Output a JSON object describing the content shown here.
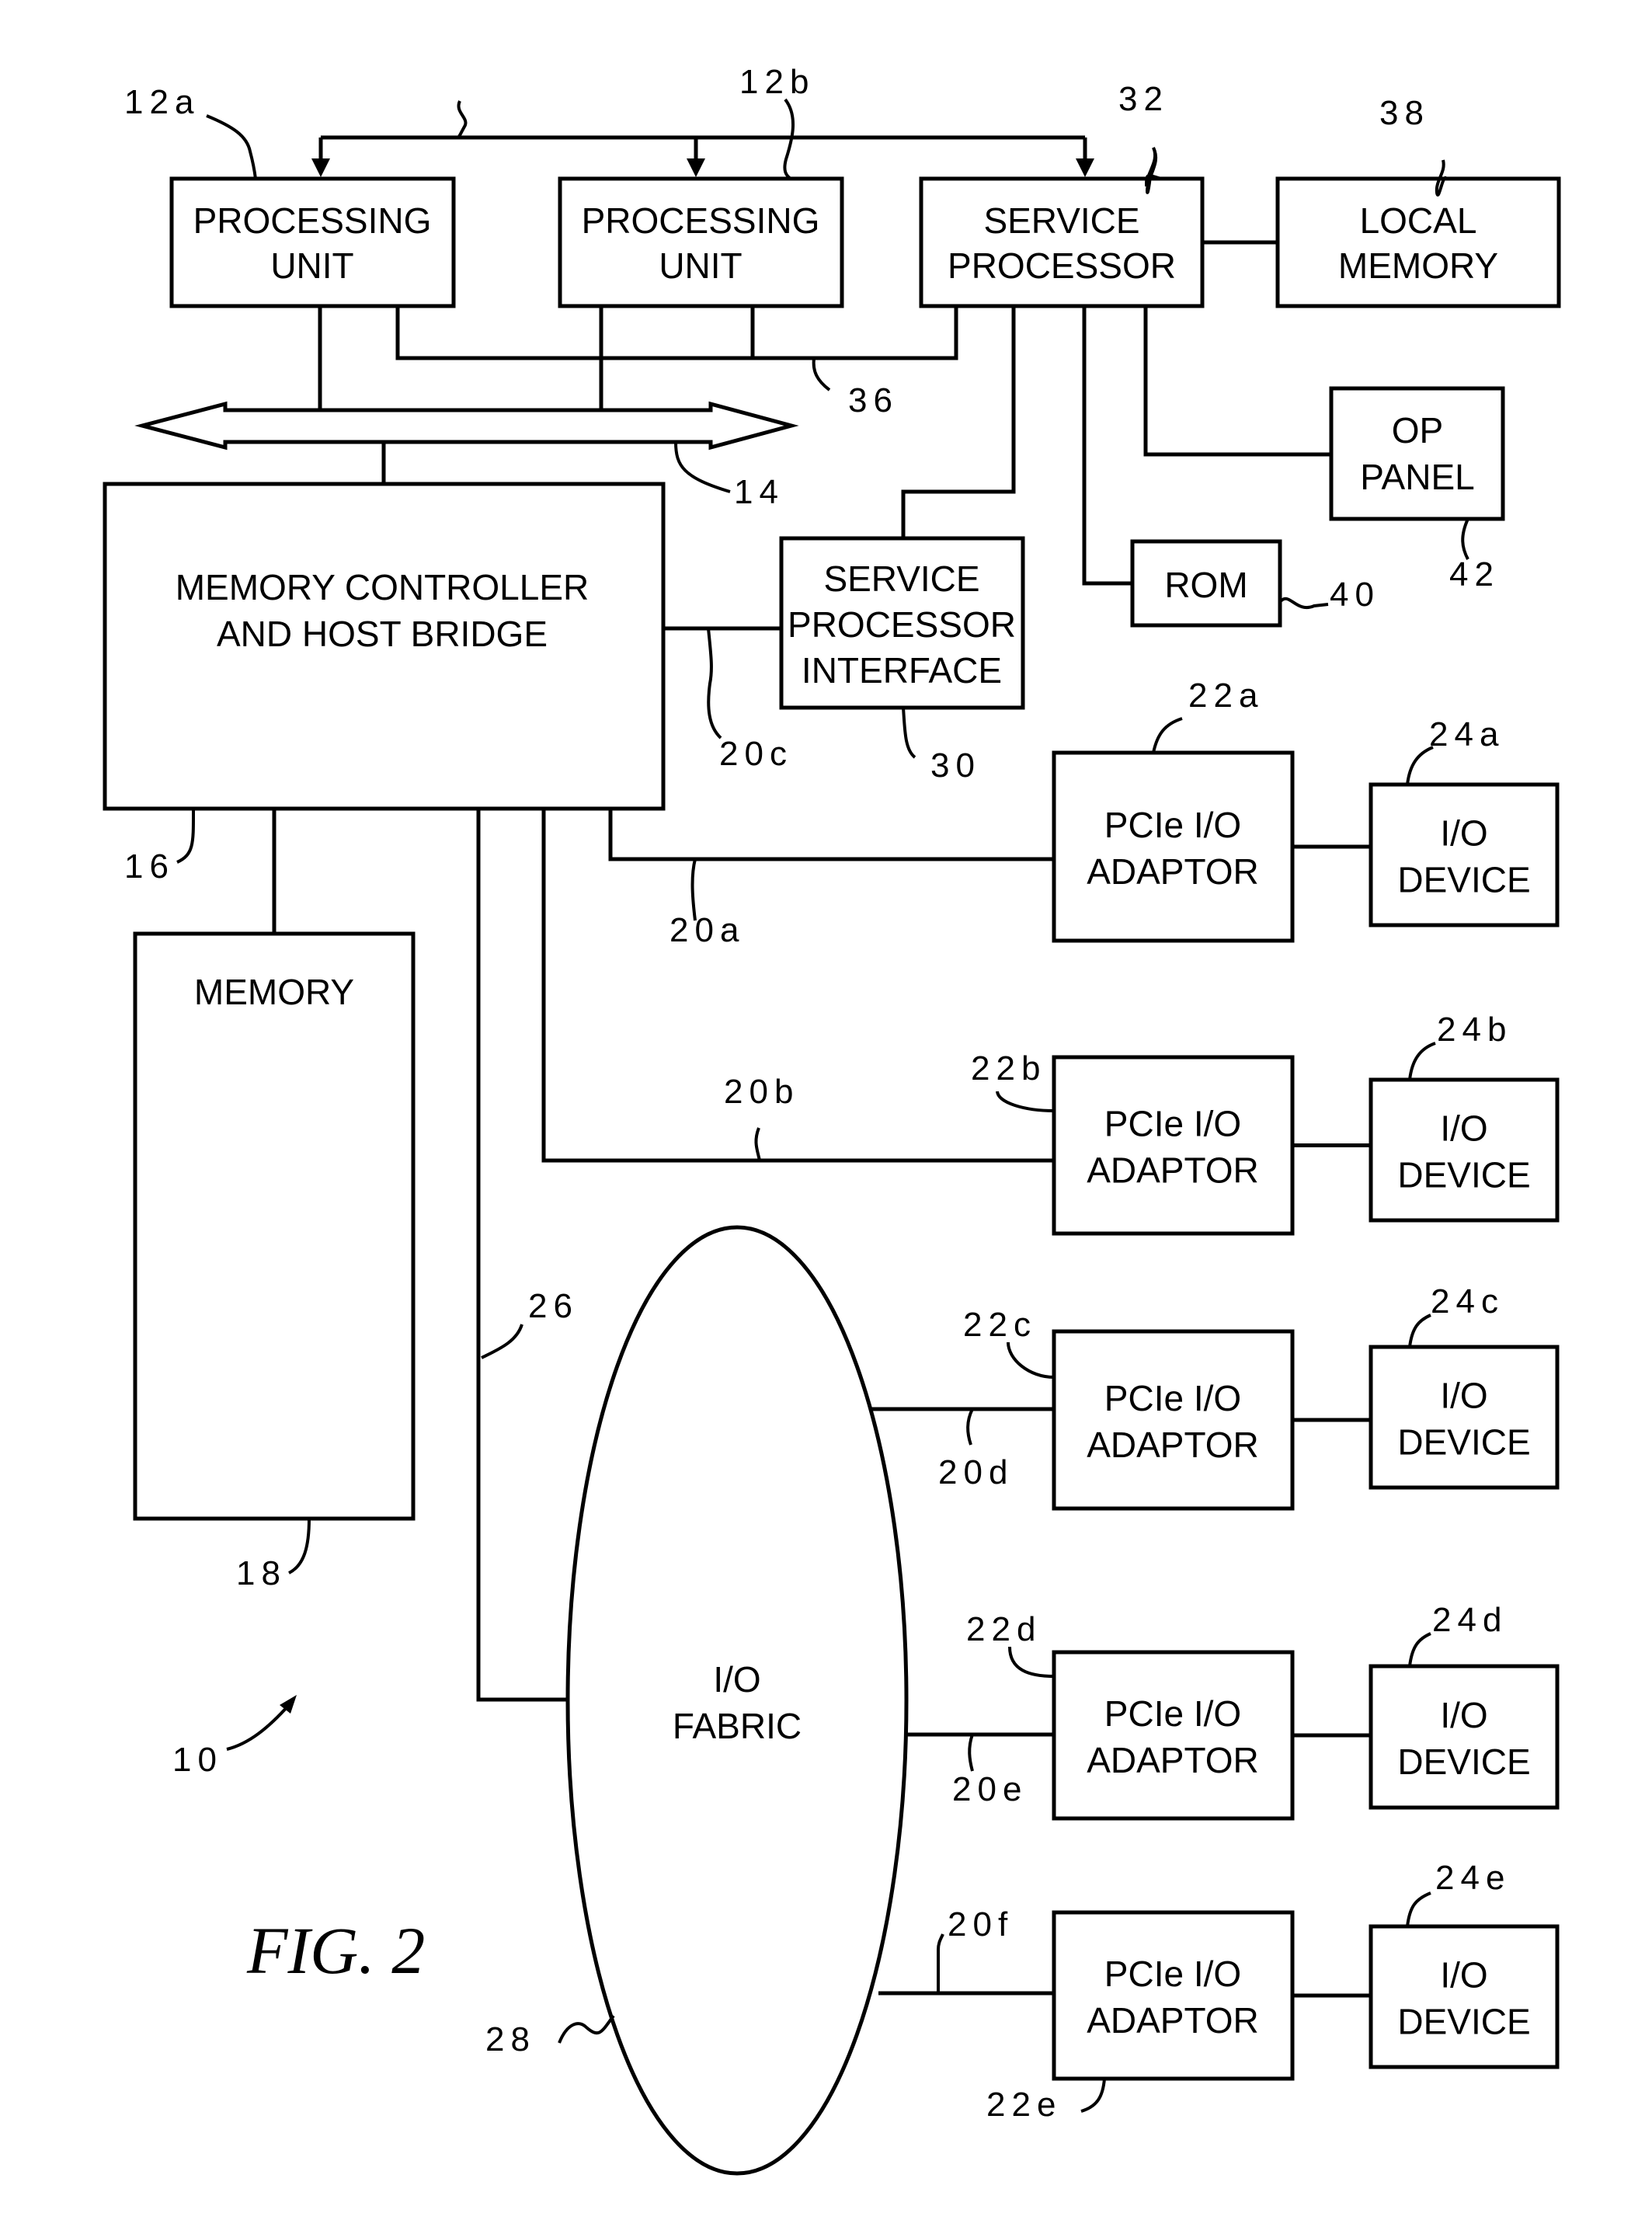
{
  "figure": {
    "caption": "FIG. 2",
    "system_ref": "10"
  },
  "blocks": {
    "processing_unit_a": {
      "line1": "PROCESSING",
      "line2": "UNIT",
      "ref": "12a"
    },
    "processing_unit_b": {
      "line1": "PROCESSING",
      "line2": "UNIT",
      "ref": "12b"
    },
    "service_processor": {
      "line1": "SERVICE",
      "line2": "PROCESSOR",
      "ref": "32"
    },
    "local_memory": {
      "line1": "LOCAL",
      "line2": "MEMORY",
      "ref": "38"
    },
    "op_panel": {
      "line1": "OP",
      "line2": "PANEL",
      "ref": "42"
    },
    "rom": {
      "line1": "ROM",
      "ref": "40"
    },
    "memory_controller": {
      "line1": "MEMORY CONTROLLER",
      "line2": "AND HOST BRIDGE",
      "ref": "16"
    },
    "service_processor_interface": {
      "line1": "SERVICE",
      "line2": "PROCESSOR",
      "line3": "INTERFACE",
      "ref": "30"
    },
    "memory": {
      "line1": "MEMORY",
      "ref": "18"
    },
    "io_fabric": {
      "line1": "I/O",
      "line2": "FABRIC",
      "ref": "28"
    }
  },
  "buses": {
    "system_bus": {
      "ref": "14"
    },
    "pu_sp_bus": {
      "ref": "36"
    },
    "fabric_link": {
      "ref": "26"
    }
  },
  "adaptors": [
    {
      "line1": "PCIe I/O",
      "line2": "ADAPTOR",
      "ref": "22a",
      "link_ref": "20a"
    },
    {
      "line1": "PCIe I/O",
      "line2": "ADAPTOR",
      "ref": "22b",
      "link_ref": "20b"
    },
    {
      "line1": "PCIe I/O",
      "line2": "ADAPTOR",
      "ref": "22c",
      "link_ref": "20d"
    },
    {
      "line1": "PCIe I/O",
      "line2": "ADAPTOR",
      "ref": "22d",
      "link_ref": "20e"
    },
    {
      "line1": "PCIe I/O",
      "line2": "ADAPTOR",
      "ref": "22e",
      "link_ref": "20f"
    }
  ],
  "devices": [
    {
      "line1": "I/O",
      "line2": "DEVICE",
      "ref": "24a"
    },
    {
      "line1": "I/O",
      "line2": "DEVICE",
      "ref": "24b"
    },
    {
      "line1": "I/O",
      "line2": "DEVICE",
      "ref": "24c"
    },
    {
      "line1": "I/O",
      "line2": "DEVICE",
      "ref": "24d"
    },
    {
      "line1": "I/O",
      "line2": "DEVICE",
      "ref": "24e"
    }
  ],
  "links": {
    "spi_link_ref": "20c"
  }
}
